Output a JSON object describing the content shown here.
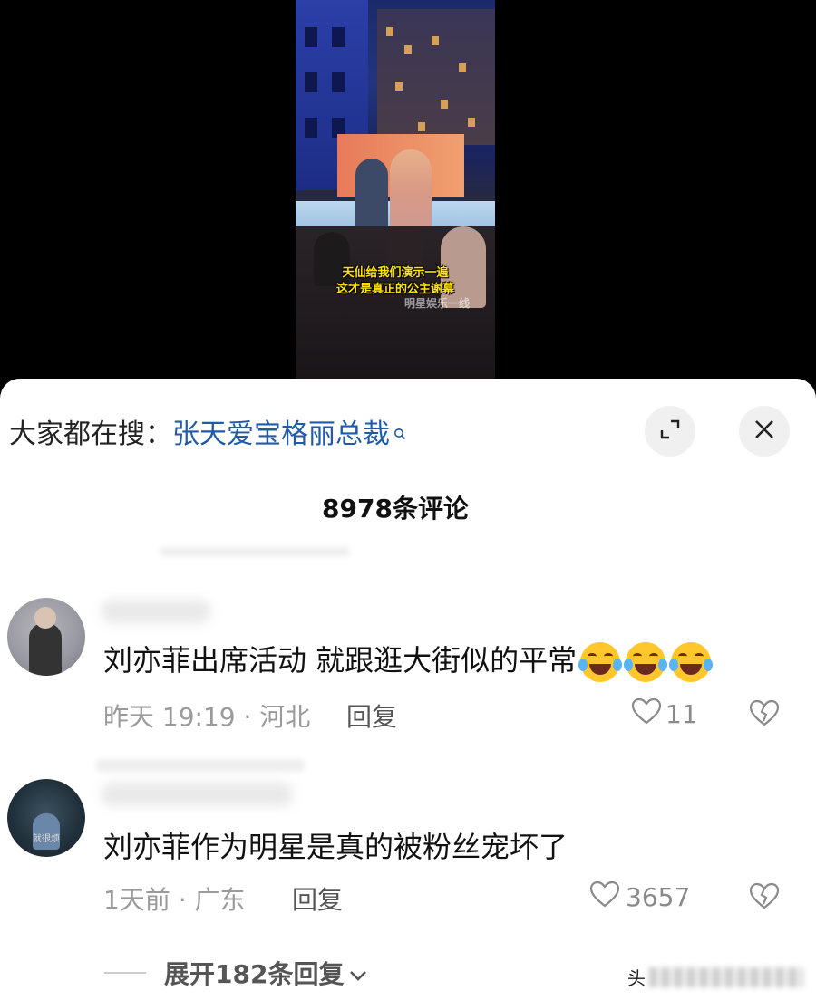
{
  "video": {
    "caption_lines": [
      "天仙给我们演示一遍",
      "这才是真正的公主谢幕"
    ],
    "watermark": "明星娱乐一线"
  },
  "search": {
    "prefix": "大家都在搜：",
    "term": "张天爱宝格丽总裁"
  },
  "comments_header": {
    "title": "8978条评论"
  },
  "comments": [
    {
      "text": "刘亦菲出席活动 就跟逛大街似的平常",
      "emoji_count": 3,
      "time_location": "昨天 19:19 · 河北",
      "reply_label": "回复",
      "likes": "11"
    },
    {
      "text": "刘亦菲作为明星是真的被粉丝宠坏了",
      "avatar_tag": "就很烦",
      "time_location": "1天前 · 广东",
      "reply_label": "回复",
      "likes": "3657"
    }
  ],
  "expand_replies": {
    "label": "展开182条回复"
  },
  "source": {
    "prefix": "头"
  },
  "colors": {
    "search_term": "#1f5ba8",
    "caption": "#ffe400",
    "meta_gray": "#9a9a9a"
  }
}
